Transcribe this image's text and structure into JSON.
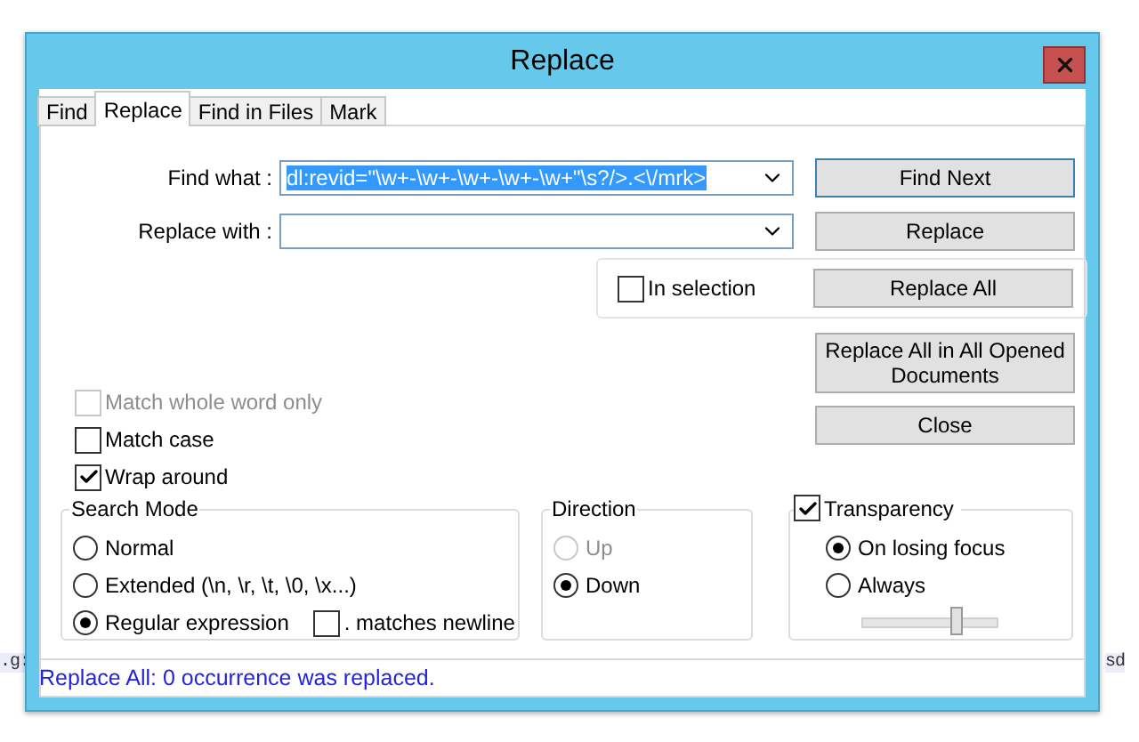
{
  "window": {
    "title": "Replace"
  },
  "tabs": [
    {
      "label": "Find",
      "selected": false
    },
    {
      "label": "Replace",
      "selected": true
    },
    {
      "label": "Find in Files",
      "selected": false
    },
    {
      "label": "Mark",
      "selected": false
    }
  ],
  "fields": [
    {
      "label": "Find what :",
      "value": "dl:revid=\"\\w+-\\w+-\\w+-\\w+-\\w+\"\\s?/>.<\\/mrk>",
      "highlighted": true
    },
    {
      "label": "Replace with :"
    }
  ],
  "in_selection": {
    "label": "In selection",
    "checked": false
  },
  "buttons": [
    {
      "label": "Find Next",
      "default": true
    },
    {
      "label": "Replace",
      "default": false
    },
    {
      "label": "Replace All",
      "default": false
    },
    {
      "label": "Replace All in All Opened Documents",
      "default": false
    },
    {
      "label": "Close",
      "default": false
    }
  ],
  "options": [
    {
      "label": "Match whole word only",
      "checked": false,
      "disabled": true
    },
    {
      "label": "Match case",
      "checked": false,
      "disabled": false
    },
    {
      "label": "Wrap around",
      "checked": true,
      "disabled": false
    }
  ],
  "search_mode": {
    "title": "Search Mode",
    "options": [
      {
        "label": "Normal",
        "selected": false,
        "disabled": false
      },
      {
        "label": "Extended (\\n, \\r, \\t, \\0, \\x...)",
        "selected": false,
        "disabled": false
      },
      {
        "label": "Regular expression",
        "selected": true,
        "disabled": false
      }
    ],
    "dot_matches_newline": {
      "label": ". matches newline",
      "checked": false
    }
  },
  "direction": {
    "title": "Direction",
    "options": [
      {
        "label": "Up",
        "selected": false,
        "disabled": true
      },
      {
        "label": "Down",
        "selected": true,
        "disabled": false
      }
    ]
  },
  "transparency": {
    "label": "Transparency",
    "checked": true,
    "options": [
      {
        "label": "On losing focus",
        "selected": true,
        "disabled": false
      },
      {
        "label": "Always",
        "selected": false,
        "disabled": false
      }
    ],
    "level": 0.7
  },
  "status": "Replace All: 0 occurrence was replaced.",
  "background_text": [
    ".g:",
    "sd"
  ]
}
